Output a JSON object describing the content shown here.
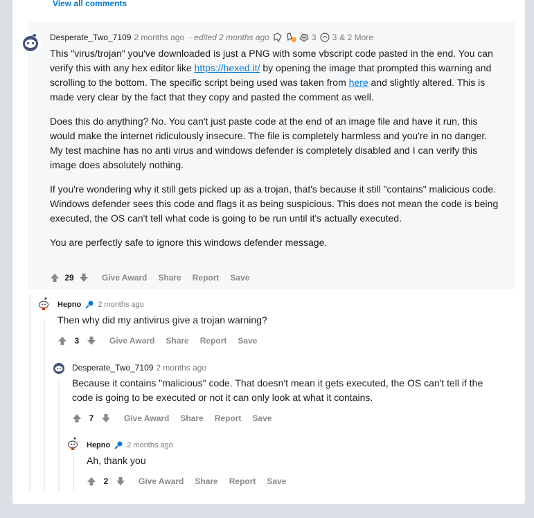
{
  "view_all_comments": "View all comments",
  "comments": [
    {
      "author": "Desperate_Two_7109",
      "time": "2 months ago",
      "separator": "·",
      "edited": "edited 2 months ago",
      "awards": [
        {
          "icon": "ribbon-award-icon",
          "count": ""
        },
        {
          "icon": "wholesome-award-icon",
          "count": ""
        },
        {
          "icon": "helpful-award-icon",
          "count": "3"
        },
        {
          "icon": "silver-award-icon",
          "count": "3"
        }
      ],
      "awards_more": "& 2 More",
      "paragraphs": [
        {
          "t1": "This \"virus/trojan\" you've downloaded is just a PNG with some vbscript code pasted in the end. You can verify this with any hex editor like ",
          "link1": "https://hexed.it/",
          "t2": " by opening the image that prompted this warning and scrolling to the bottom. The specific script being used was taken from ",
          "link2": "here",
          "t3": " and slightly altered. This is made very clear by the fact that they copy and pasted the comment as well."
        },
        "Does this do anything? No. You can't just paste code at the end of an image file and have it run, this would make the internet ridiculously insecure. The file is completely harmless and you're in no danger. My test machine has no anti virus and windows defender is completely disabled and I can verify this image does absolutely nothing.",
        "If you're wondering why it still gets picked up as a trojan, that's because it still \"contains\" malicious code. Windows defender sees this code and flags it as being suspicious. This does not mean the code is being executed, the OS can't tell what code is going to be run until it's actually executed.",
        "You are perfectly safe to ignore this windows defender message."
      ],
      "score": "29"
    },
    {
      "author": "Hepno",
      "time": "2 months ago",
      "body": "Then why did my antivirus give a trojan warning?",
      "score": "3"
    },
    {
      "author": "Desperate_Two_7109",
      "time": "2 months ago",
      "body": "Because it contains \"malicious\" code. That doesn't mean it gets executed, the OS can't tell if the code is going to be executed or not it can only look at what it contains.",
      "score": "7"
    },
    {
      "author": "Hepno",
      "time": "2 months ago",
      "body": "Ah, thank you",
      "score": "2"
    }
  ],
  "actions": {
    "give_award": "Give Award",
    "share": "Share",
    "report": "Report",
    "save": "Save"
  },
  "colors": {
    "page_bg": "#dae0e6",
    "card_bg": "#ffffff",
    "highlight_bg": "#f6f7f8",
    "link": "#0079d3",
    "meta_text": "#7c7c7c",
    "action_text": "#878a8c",
    "thread_line": "#edeff1"
  }
}
